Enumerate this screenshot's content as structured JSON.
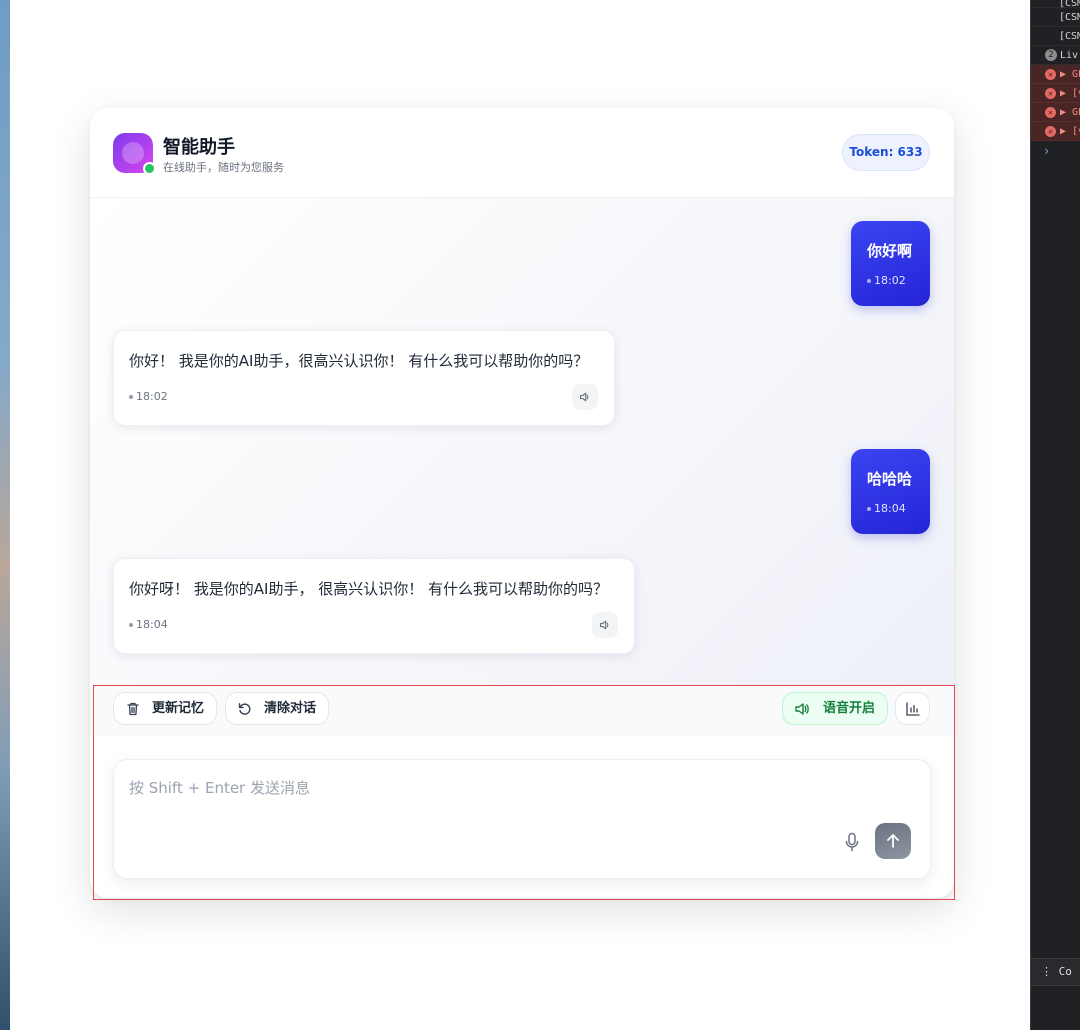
{
  "header": {
    "title": "智能助手",
    "subtitle": "在线助手，随时为您服务",
    "token_label": "Token: 633"
  },
  "messages": [
    {
      "role": "user",
      "text": "你好啊",
      "time": "18:02"
    },
    {
      "role": "assistant",
      "text": "你好！ 我是你的AI助手，很高兴认识你！ 有什么我可以帮助你的吗？",
      "time": "18:02",
      "icon": "speaker-icon"
    },
    {
      "role": "user",
      "text": "哈哈哈",
      "time": "18:04"
    },
    {
      "role": "assistant",
      "text": "你好呀！ 我是你的AI助手， 很高兴认识你！ 有什么我可以帮助你的吗？",
      "time": "18:04",
      "icon": "speaker-icon"
    }
  ],
  "toolbar": {
    "update_memory_label": "更新记忆",
    "update_memory_icon": "trash-icon",
    "clear_chat_label": "清除对话",
    "clear_chat_icon": "reset-icon",
    "voice_label": "语音开启",
    "voice_icon": "speaker-icon",
    "stats_icon": "bar-chart-icon"
  },
  "input": {
    "placeholder": "按 Shift + Enter 发送消息",
    "value": "",
    "mic_icon": "microphone-icon",
    "send_icon": "arrow-up-icon"
  },
  "devtools": {
    "log_lines": [
      "[CSM",
      "[CSM",
      "[CSM"
    ],
    "badge_count": "2",
    "badge_text": "Liv",
    "errors": [
      "▶ GE",
      "▶ [v",
      "▶ GE",
      "▶ [v"
    ],
    "prompt": "›",
    "bottom_label": "Co"
  },
  "colors": {
    "user_bubble": "#2f33e6",
    "accent_green": "#15803d",
    "token_blue": "#1d4ed8",
    "online": "#22c55e",
    "selection": "#e5484d"
  }
}
